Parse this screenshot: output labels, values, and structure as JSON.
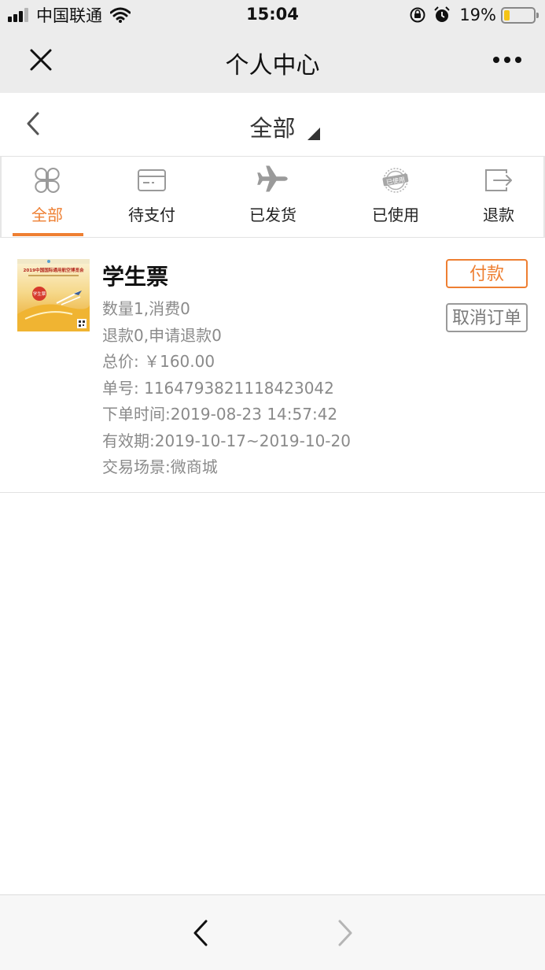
{
  "status_bar": {
    "carrier": "中国联通",
    "time": "15:04",
    "battery_percent": "19%",
    "battery_level": 0.19,
    "icons": [
      "signal-icon",
      "wifi-icon",
      "rotation-lock-icon",
      "alarm-icon",
      "battery-icon"
    ]
  },
  "navbar": {
    "title": "个人中心",
    "icons": [
      "close-icon",
      "more-icon"
    ]
  },
  "page_header": {
    "filter_title": "全部",
    "icons": [
      "back-chevron-icon",
      "dropdown-caret-icon"
    ]
  },
  "tabs": [
    {
      "label": "全部",
      "icon": "four-petal-icon",
      "active": true
    },
    {
      "label": "待支付",
      "icon": "card-icon",
      "active": false
    },
    {
      "label": "已发货",
      "icon": "airplane-icon",
      "active": false
    },
    {
      "label": "已使用",
      "icon": "used-stamp-icon",
      "active": false
    },
    {
      "label": "退款",
      "icon": "exit-arrow-icon",
      "active": false
    }
  ],
  "colors": {
    "accent": "#ee7f32",
    "bar_bg": "#ececec",
    "muted_text": "#8a8a8a"
  },
  "order": {
    "title": "学生票",
    "quantity_line": "数量1,消费0",
    "refund_line": "退款0,申请退款0",
    "price_line": "总价: ￥160.00",
    "order_no_line": "单号: 1164793821118423042",
    "order_time_line": "下单时间:2019-08-23 14:57:42",
    "validity_line": "有效期:2019-10-17~2019-10-20",
    "scene_line": "交易场景:微商城",
    "pay_button": "付款",
    "cancel_button": "取消订单",
    "thumbnail": {
      "heading": "2019中国国际通用航空博览会",
      "badge": "学生票"
    }
  },
  "bottom_bar": {
    "icons": [
      "back-arrow-icon",
      "forward-arrow-icon"
    ]
  }
}
